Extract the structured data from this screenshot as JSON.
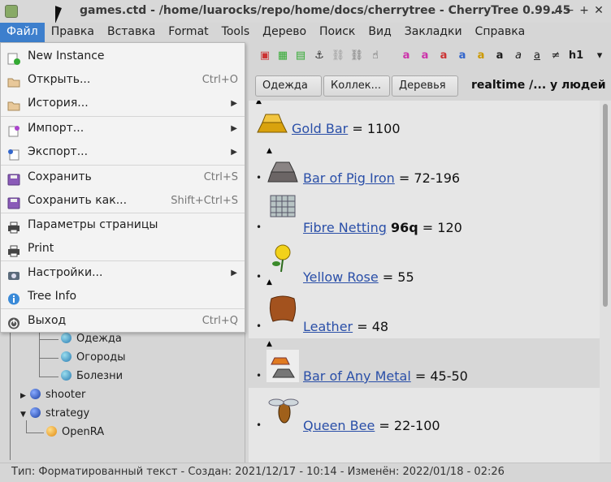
{
  "window": {
    "title": "games.ctd - /home/luarocks/repo/home/docs/cherrytree - CherryTree 0.99.45",
    "minimize": "−",
    "maximize": "+",
    "close": "✕",
    "restore": "⌄"
  },
  "menubar": [
    "Файл",
    "Правка",
    "Вставка",
    "Format",
    "Tools",
    "Дерево",
    "Поиск",
    "Вид",
    "Закладки",
    "Справка"
  ],
  "file_menu": {
    "items": [
      {
        "label": "New Instance",
        "accel": "",
        "icon": "new-instance-icon"
      },
      {
        "label": "Открыть...",
        "accel": "Ctrl+O",
        "icon": "folder-icon"
      },
      {
        "label": "История...",
        "accel": "",
        "icon": "folder-icon",
        "submenu": true
      },
      {
        "label": "Импорт...",
        "accel": "",
        "icon": "import-icon",
        "submenu": true
      },
      {
        "label": "Экспорт...",
        "accel": "",
        "icon": "export-icon",
        "submenu": true
      },
      {
        "label": "Сохранить",
        "accel": "Ctrl+S",
        "icon": "save-icon"
      },
      {
        "label": "Сохранить как...",
        "accel": "Shift+Ctrl+S",
        "icon": "save-as-icon"
      },
      {
        "label": "Параметры страницы",
        "accel": "",
        "icon": "printer-icon"
      },
      {
        "label": "Print",
        "accel": "",
        "icon": "printer-icon"
      },
      {
        "label": "Настройки...",
        "accel": "",
        "icon": "preferences-icon",
        "submenu": true
      },
      {
        "label": "Tree Info",
        "accel": "",
        "icon": "info-icon"
      },
      {
        "label": "Выход",
        "accel": "Ctrl+Q",
        "icon": "power-icon"
      }
    ],
    "submenu_arrow": "▶"
  },
  "tree": {
    "items": [
      {
        "label": "Одежда"
      },
      {
        "label": "Огороды"
      },
      {
        "label": "Болезни"
      },
      {
        "label": "shooter",
        "arrow": "▶"
      },
      {
        "label": "strategy",
        "arrow": "▼"
      },
      {
        "label": "OpenRA"
      }
    ]
  },
  "breadcrumbs": {
    "buttons": [
      "Одежда",
      "Коллек...",
      "Деревья"
    ],
    "current": "realtime /... у людей"
  },
  "content": {
    "triangle": "▲",
    "bullet": "•",
    "items": [
      {
        "link": "Gold Bar",
        "bold": "",
        "rest": " = 1100",
        "bullet": false
      },
      {
        "link": "Bar of Pig Iron",
        "bold": "",
        "rest": " = 72-196",
        "bullet": true
      },
      {
        "link": "Fibre Netting",
        "bold": "96q",
        "rest": " = 120",
        "bullet": true
      },
      {
        "link": "Yellow Rose",
        "bold": "",
        "rest": " = 55",
        "bullet": true
      },
      {
        "link": "Leather",
        "bold": "",
        "rest": " = 48",
        "bullet": true
      },
      {
        "link": "Bar of Any Metal",
        "bold": "",
        "rest": " = 45-50",
        "bullet": true
      },
      {
        "link": "Queen Bee",
        "bold": "",
        "rest": " = 22-100",
        "bullet": true
      }
    ]
  },
  "toolbar": {
    "labels": [
      "a",
      "a",
      "a",
      "a",
      "a",
      "a",
      "a",
      "a",
      "h1"
    ],
    "more": "▾"
  },
  "statusbar": {
    "text": "Тип: Форматированный текст  -  Создан: 2021/12/17 - 10:14  -  Изменён: 2022/01/18 - 02:26"
  },
  "colors": {
    "menu_highlight": "#3d7fcd",
    "link": "#2a4fa8"
  }
}
